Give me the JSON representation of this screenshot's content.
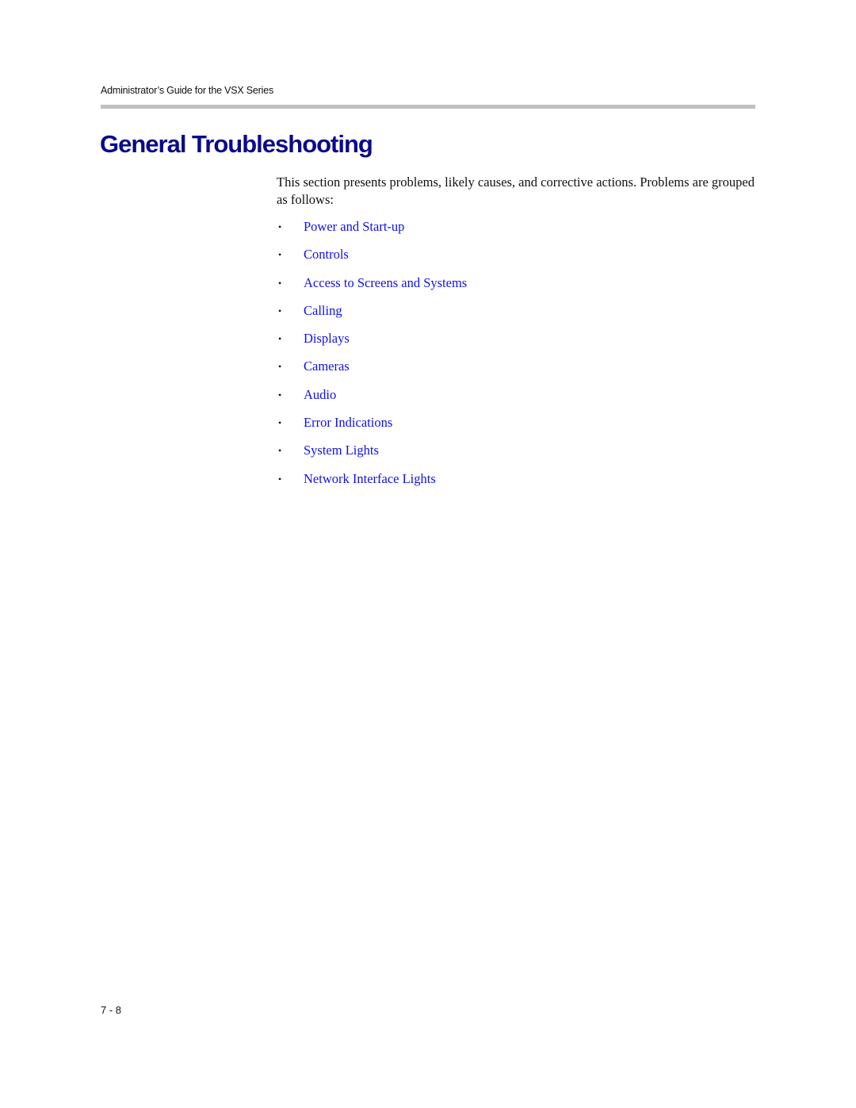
{
  "header": {
    "running_title": "Administrator’s Guide for the VSX Series"
  },
  "section": {
    "title": "General Troubleshooting",
    "intro": "This section presents problems, likely causes, and corrective actions. Problems are grouped as follows:",
    "topics": [
      {
        "label": "Power and Start-up"
      },
      {
        "label": "Controls"
      },
      {
        "label": "Access to Screens and Systems"
      },
      {
        "label": "Calling"
      },
      {
        "label": "Displays"
      },
      {
        "label": "Cameras"
      },
      {
        "label": "Audio"
      },
      {
        "label": "Error Indications"
      },
      {
        "label": "System Lights"
      },
      {
        "label": "Network Interface Lights"
      }
    ],
    "bullet_glyph": "•",
    "link_color": "#1010ee",
    "title_color": "#0a0a8a"
  },
  "footer": {
    "page_number": "7 - 8"
  }
}
